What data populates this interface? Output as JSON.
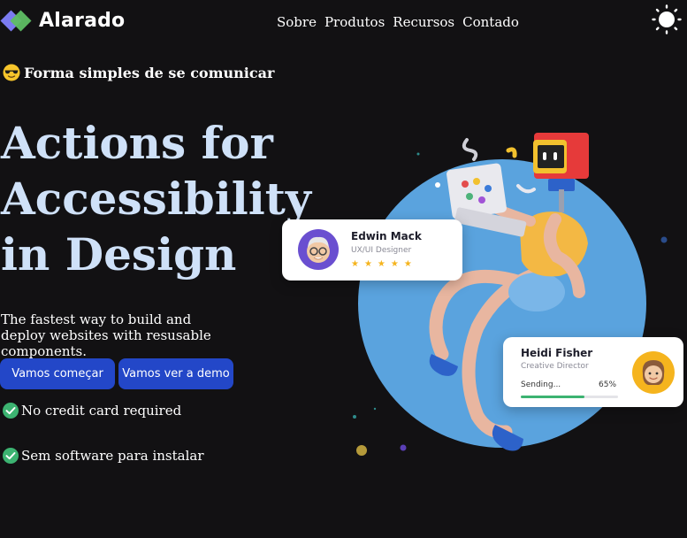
{
  "brand": {
    "name": "Alarado"
  },
  "nav": {
    "items": [
      "Sobre",
      "Produtos",
      "Recursos",
      "Contado"
    ]
  },
  "tagline": {
    "emoji": "sunglasses-face",
    "text": "Forma simples de se comunicar"
  },
  "hero": {
    "title_lines": [
      "Actions for",
      "Accessibility",
      "in Design"
    ],
    "subtitle": "The fastest way to build and deploy websites with resusable components."
  },
  "buttons": {
    "start": "Vamos começar",
    "demo": "Vamos ver a demo"
  },
  "features": [
    "No credit card required",
    "Sem software para instalar"
  ],
  "cards": {
    "edwin": {
      "name": "Edwin Mack",
      "role": "UX/UI Designer",
      "stars": 5
    },
    "heidi": {
      "name": "Heidi Fisher",
      "role": "Creative Director",
      "progress_label": "Sending...",
      "progress_value": "65%",
      "progress_fraction": 0.65
    }
  },
  "colors": {
    "background": "#121113",
    "title": "#cfe1f8",
    "button": "#2347c8",
    "circle": "#5aa3de",
    "check": "#3cb371"
  }
}
